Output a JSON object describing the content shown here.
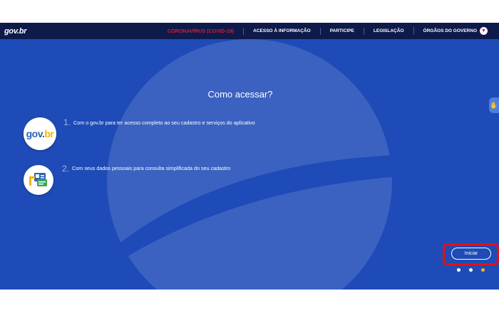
{
  "header": {
    "brand": "gov.br",
    "nav": [
      {
        "label": "CORONAVÍRUS (COVID-19)"
      },
      {
        "label": "ACESSO À INFORMAÇÃO"
      },
      {
        "label": "PARTICIPE"
      },
      {
        "label": "LEGISLAÇÃO"
      },
      {
        "label": "ÓRGÃOS DO GOVERNO"
      }
    ],
    "chevron_icon": "chevron-down-icon"
  },
  "main": {
    "title": "Como acessar?",
    "steps": [
      {
        "number": "1.",
        "text": "Com o gov.br para ter acesso completo ao seu cadastro e serviços do aplicativo",
        "icon": "govbr-logo-icon",
        "logo_a": "gov.",
        "logo_b": "br"
      },
      {
        "number": "2.",
        "text": "Com seus dados pessoais para consulta simplificada do seu cadastro",
        "icon": "id-card-icon"
      }
    ],
    "start_label": "Iniciar",
    "accessibility_icon": "sign-language-icon"
  },
  "colors": {
    "topbar": "#0d1a4a",
    "background": "#1e4bb8",
    "alert": "#e5162f",
    "accent": "#f4b400",
    "highlight": "#e31010"
  },
  "carousel": {
    "count": 3,
    "active": 3
  }
}
